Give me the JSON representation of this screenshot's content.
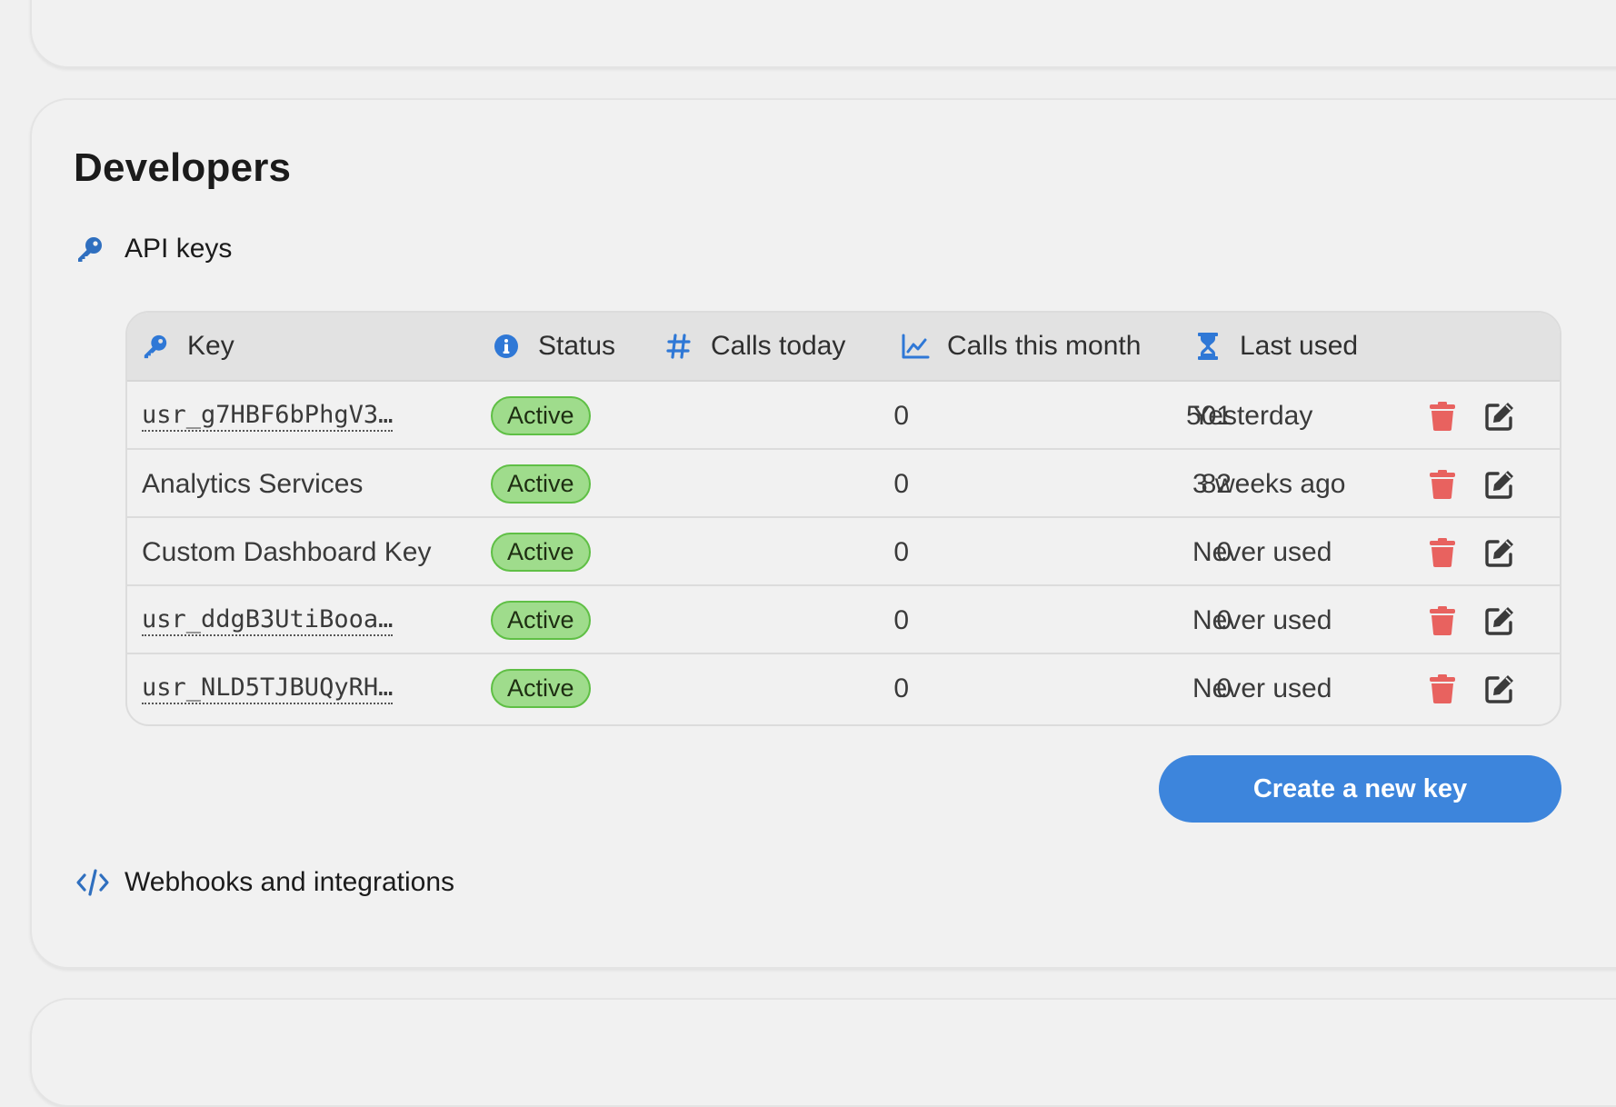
{
  "section": {
    "title": "Developers"
  },
  "api_keys": {
    "heading": "API keys",
    "columns": {
      "key": "Key",
      "status": "Status",
      "calls_today": "Calls today",
      "calls_month": "Calls this month",
      "last_used": "Last used"
    },
    "rows": [
      {
        "key": "usr_g7HBF6bPhgV3…",
        "status": "Active",
        "calls_today": "0",
        "calls_month": "501",
        "last_used": "Yesterday"
      },
      {
        "key": "Analytics Services",
        "status": "Active",
        "calls_today": "0",
        "calls_month": "82",
        "last_used": "3 weeks ago"
      },
      {
        "key": "Custom Dashboard Key",
        "status": "Active",
        "calls_today": "0",
        "calls_month": "0",
        "last_used": "Never used"
      },
      {
        "key": "usr_ddgB3UtiBooa…",
        "status": "Active",
        "calls_today": "0",
        "calls_month": "0",
        "last_used": "Never used"
      },
      {
        "key": "usr_NLD5TJBUQyRH…",
        "status": "Active",
        "calls_today": "0",
        "calls_month": "0",
        "last_used": "Never used"
      }
    ],
    "create_button": "Create a new key"
  },
  "webhooks": {
    "heading": "Webhooks and integrations"
  },
  "icons": {
    "key": "key-icon",
    "info": "info-circle-icon",
    "hash": "hash-icon",
    "chart": "line-chart-icon",
    "hourglass": "hourglass-icon",
    "trash": "trash-icon",
    "edit": "edit-icon",
    "code": "code-icon"
  },
  "colors": {
    "accent": "#3d85dc",
    "icon_blue": "#2f78d6",
    "badge_bg": "#9fdc8c",
    "badge_border": "#5fbf45",
    "danger": "#e8625f",
    "edit_icon": "#3a3a3a"
  }
}
